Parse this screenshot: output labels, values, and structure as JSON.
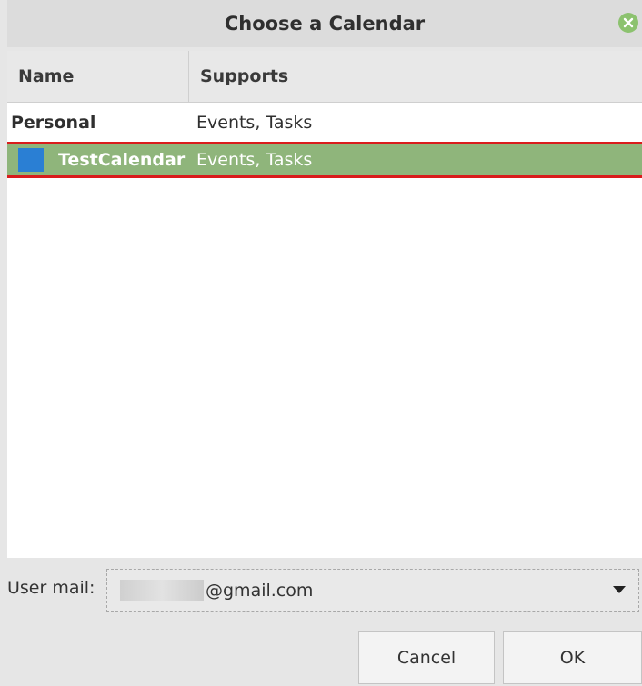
{
  "window": {
    "title": "Choose a Calendar"
  },
  "list": {
    "columns": [
      "Name",
      "Supports"
    ],
    "rows": [
      {
        "name": "Personal",
        "supports": "Events, Tasks",
        "selected": false
      },
      {
        "name": "TestCalendar",
        "supports": "Events, Tasks",
        "selected": true,
        "color": "#2a7fd4"
      }
    ]
  },
  "footer": {
    "mail_label": "User mail:",
    "mail_value": "@gmail.com",
    "cancel_label": "Cancel",
    "ok_label": "OK"
  },
  "colors": {
    "selection": "#8fb57b",
    "highlight_border": "#d91c1c",
    "close_button": "#8cc26f"
  }
}
